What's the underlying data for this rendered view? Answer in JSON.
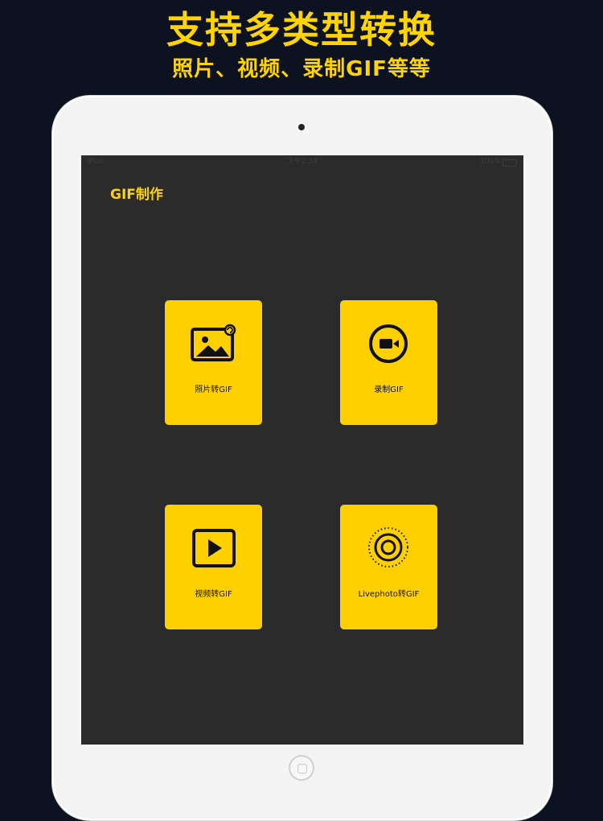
{
  "banner": {
    "title": "支持多类型转换",
    "subtitle": "照片、视频、录制GIF等等"
  },
  "status_bar": {
    "carrier": "iPad",
    "time": "下午2:34",
    "battery": "100%"
  },
  "app": {
    "title": "GIF制作"
  },
  "menu": {
    "photo_to_gif": {
      "label": "照片转GIF",
      "icon": "photo-icon"
    },
    "record_gif": {
      "label": "录制GIF",
      "icon": "video-camera-icon"
    },
    "video_to_gif": {
      "label": "视频转GIF",
      "icon": "play-icon"
    },
    "livephoto_to_gif": {
      "label": "Livephoto转GIF",
      "icon": "live-photo-icon"
    }
  },
  "colors": {
    "accent": "#ffd400",
    "card": "#ffd000",
    "screen": "#2b2b2b",
    "background": "#0d1220"
  }
}
